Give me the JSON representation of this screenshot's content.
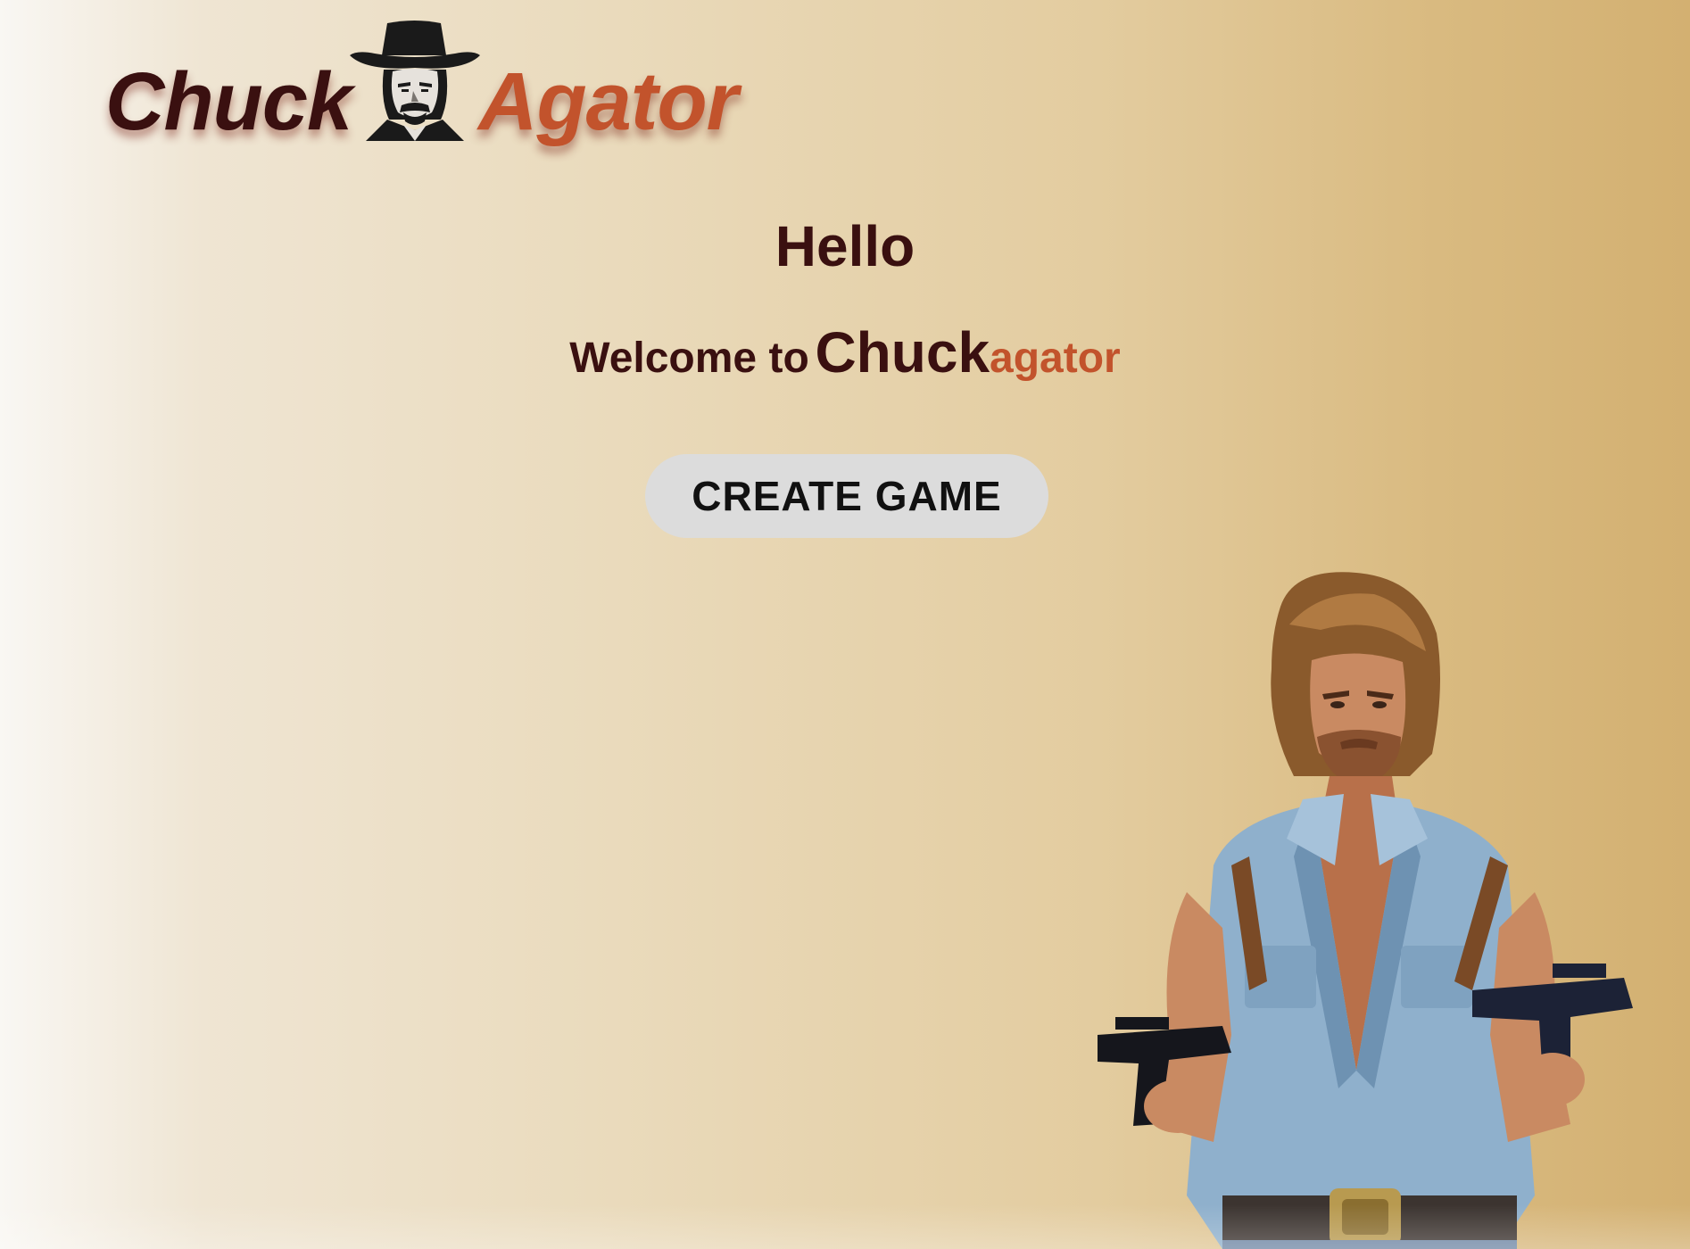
{
  "logo": {
    "left_word": "Chuck",
    "right_word": "Agator",
    "face_icon": "chuck-face-with-cowboy-hat"
  },
  "greeting": {
    "hello": "Hello",
    "welcome_prefix": "Welcome to",
    "brand_first": "Chuck",
    "brand_second": "agator"
  },
  "actions": {
    "create_game_label": "CREATE GAME"
  },
  "hero": {
    "icon": "chuck-figure-with-guns"
  },
  "colors": {
    "brand_dark": "#3a1010",
    "brand_accent": "#c2532c",
    "button_bg": "#dcdcdc",
    "background_light": "#f9f7f3",
    "background_gold": "#d3b071"
  }
}
